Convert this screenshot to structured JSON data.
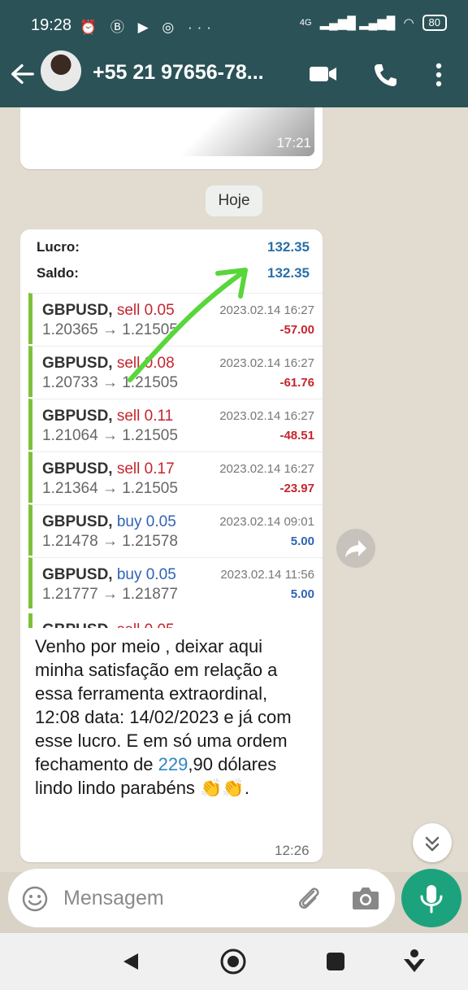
{
  "status": {
    "time": "19:28",
    "network": "4G",
    "battery": "80"
  },
  "header": {
    "contact": "+55 21 97656-78..."
  },
  "chat": {
    "prev_time": "17:21",
    "day_divider": "Hoje",
    "summary": {
      "lucro_label": "Lucro:",
      "lucro_value": "132.35",
      "saldo_label": "Saldo:",
      "saldo_value": "132.35"
    },
    "trades": [
      {
        "symbol": "GBPUSD,",
        "side": "sell",
        "lots": "0.05",
        "prices": "1.20365 → 1.21505",
        "datetime": "2023.02.14 16:27",
        "pnl": "-57.00"
      },
      {
        "symbol": "GBPUSD,",
        "side": "sell",
        "lots": "0.08",
        "prices": "1.20733 → 1.21505",
        "datetime": "2023.02.14 16:27",
        "pnl": "-61.76"
      },
      {
        "symbol": "GBPUSD,",
        "side": "sell",
        "lots": "0.11",
        "prices": "1.21064 → 1.21505",
        "datetime": "2023.02.14 16:27",
        "pnl": "-48.51"
      },
      {
        "symbol": "GBPUSD,",
        "side": "sell",
        "lots": "0.17",
        "prices": "1.21364 → 1.21505",
        "datetime": "2023.02.14 16:27",
        "pnl": "-23.97"
      },
      {
        "symbol": "GBPUSD,",
        "side": "buy",
        "lots": "0.05",
        "prices": "1.21478 → 1.21578",
        "datetime": "2023.02.14 09:01",
        "pnl": "5.00"
      },
      {
        "symbol": "GBPUSD,",
        "side": "buy",
        "lots": "0.05",
        "prices": "1.21777 → 1.21877",
        "datetime": "2023.02.14 11:56",
        "pnl": "5.00"
      }
    ],
    "message_part1": "Venho por meio , deixar aqui minha satisfação em relação a essa ferramenta extraordinal,  12:08 data: 14/02/2023 e já com esse lucro. E em só uma ordem fechamento de ",
    "message_highlight": "229",
    "message_part2": ",90 dólares lindo lindo parabéns 👏👏.",
    "message_time": "12:26"
  },
  "composer": {
    "placeholder": "Mensagem"
  },
  "colors": {
    "header": "#2b5257",
    "accent": "#1ca37e",
    "sell": "#c4262e",
    "buy": "#2f63b5"
  },
  "icons": [
    "back-arrow-icon",
    "video-call-icon",
    "phone-icon",
    "more-vert-icon",
    "forward-icon",
    "chevron-down-icon",
    "emoji-icon",
    "attach-icon",
    "camera-icon",
    "mic-icon",
    "nav-back-icon",
    "nav-home-icon",
    "nav-recents-icon",
    "nav-assist-icon"
  ]
}
